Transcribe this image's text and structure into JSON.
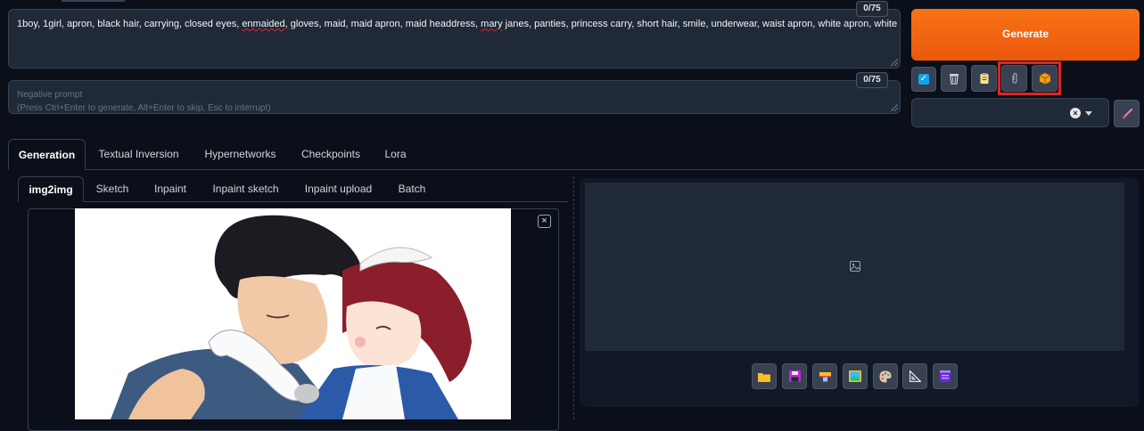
{
  "prompt": {
    "segments": [
      {
        "text": "1boy, 1girl, apron, black hair, carrying, closed eyes, ",
        "err": false
      },
      {
        "text": "enmaided",
        "err": true
      },
      {
        "text": ", gloves, maid, maid apron, maid headdress, ",
        "err": false
      },
      {
        "text": "mary",
        "err": true
      },
      {
        "text": " janes, panties, princess carry, short hair, smile, underwear, waist apron, white apron, white gloves",
        "err": false
      }
    ],
    "counter": "0/75"
  },
  "negative_prompt": {
    "placeholder_line1": "Negative prompt",
    "placeholder_line2": "(Press Ctrl+Enter to generate, Alt+Enter to skip, Esc to interrupt)",
    "counter": "0/75"
  },
  "generate": {
    "label": "Generate",
    "color": "#f97316"
  },
  "toolbar_icons": [
    "checkbox-icon",
    "trash-icon",
    "clipboard-icon",
    "paperclip-icon",
    "package-icon"
  ],
  "style_dropdown": {
    "value": ""
  },
  "main_tabs": [
    "Generation",
    "Textual Inversion",
    "Hypernetworks",
    "Checkpoints",
    "Lora"
  ],
  "sub_tabs": [
    "img2img",
    "Sketch",
    "Inpaint",
    "Inpaint sketch",
    "Inpaint upload",
    "Batch"
  ],
  "output_icons": [
    "folder-icon",
    "save-icon",
    "zip-icon",
    "image-icon",
    "palette-icon",
    "ruler-icon",
    "film-icon"
  ],
  "highlight_color": "#dc2626"
}
